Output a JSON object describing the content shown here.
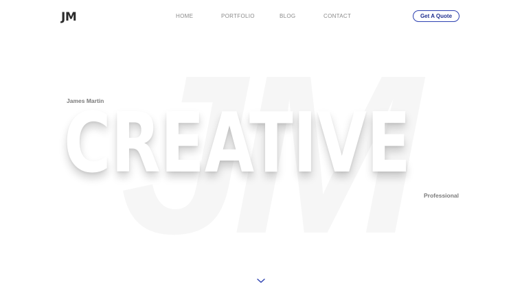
{
  "header": {
    "logo": "JM",
    "nav": {
      "home": "HOME",
      "portfolio": "PORTFOLIO",
      "blog": "BLOG",
      "contact": "CONTACT"
    },
    "cta_label": "Get A Quote"
  },
  "hero": {
    "monogram": "JM",
    "name": "James Martin",
    "headline": "CREATIVE",
    "tagline": "Professional"
  },
  "colors": {
    "accent": "#2b3fb0",
    "text_muted": "#7a7a7a",
    "monogram": "#f6f6f6"
  },
  "icons": {
    "scroll": "chevron-down-icon"
  }
}
